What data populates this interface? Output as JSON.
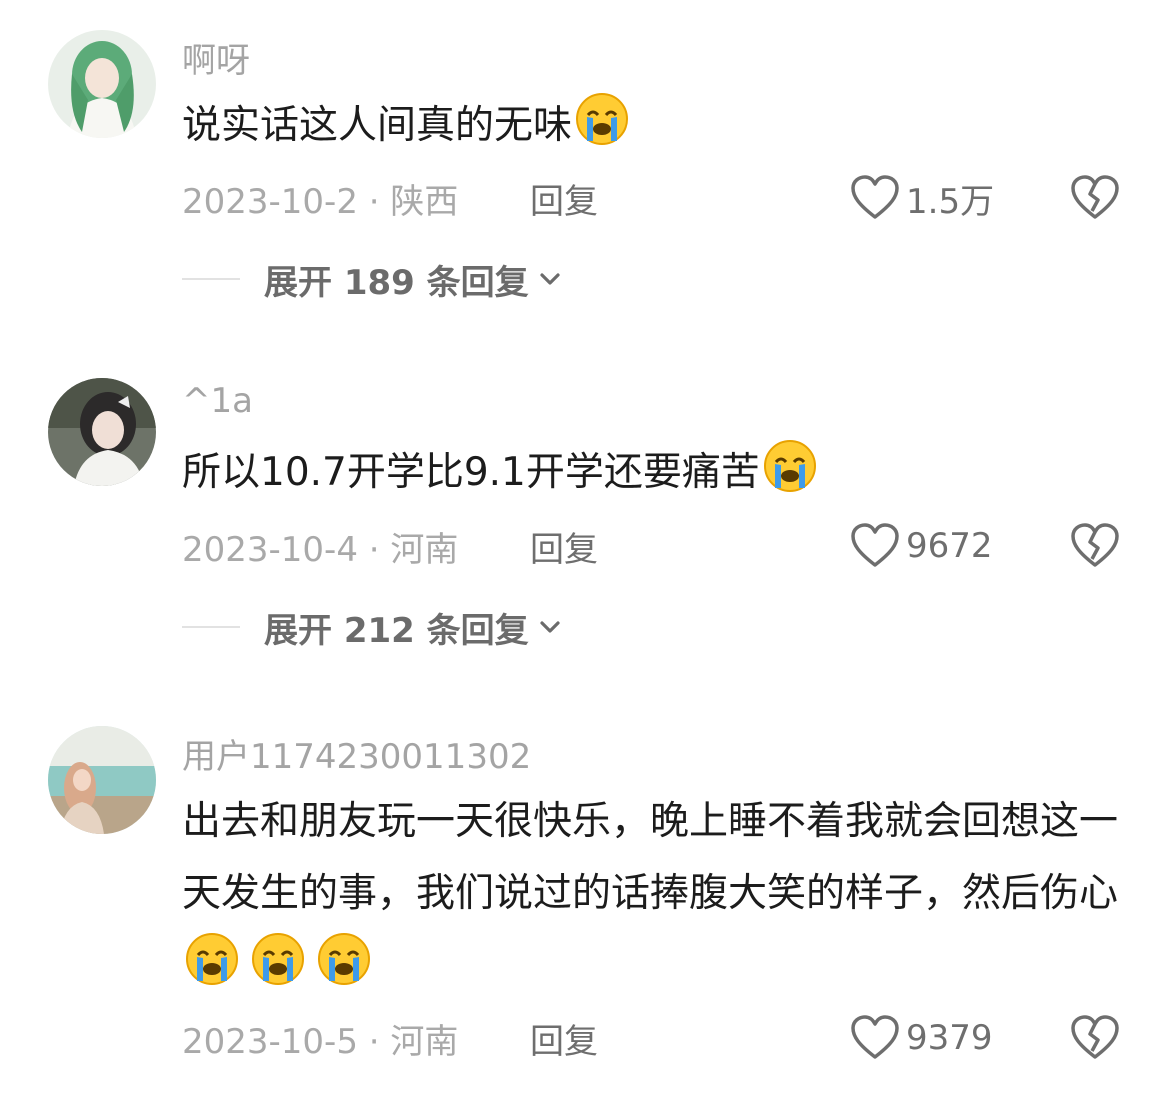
{
  "colors": {
    "meta_gray": "#a9a9a9",
    "action_gray": "#6e6e6e",
    "emoji_yellow": "#ffcc33",
    "tear_blue": "#3e9be9"
  },
  "comments": [
    {
      "username": "啊呀",
      "text": "说实话这人间真的无味",
      "emoji_count": 1,
      "date_location": "2023-10-2 · 陕西",
      "reply_label": "回复",
      "likes": "1.5万",
      "expand_label": "展开 189 条回复",
      "avatar_icon": "green-hair-girl-avatar"
    },
    {
      "username": "^1a",
      "text": "所以10.7开学比9.1开学还要痛苦",
      "emoji_count": 1,
      "date_location": "2023-10-4 · 河南",
      "reply_label": "回复",
      "likes": "9672",
      "expand_label": "展开 212 条回复",
      "avatar_icon": "dark-hair-girl-avatar"
    },
    {
      "username": "用户1174230011302",
      "text": "出去和朋友玩一天很快乐，晚上睡不着我就会回想这一天发生的事，我们说过的话捧腹大笑的样子，然后伤心",
      "emoji_count": 3,
      "date_location": "2023-10-5 · 河南",
      "reply_label": "回复",
      "likes": "9379",
      "avatar_icon": "seaside-girl-avatar"
    }
  ],
  "icons": {
    "like": "heart-outline-icon",
    "dislike": "broken-heart-icon",
    "emoji": "loudly-crying-face-emoji",
    "expand": "chevron-down-icon"
  }
}
